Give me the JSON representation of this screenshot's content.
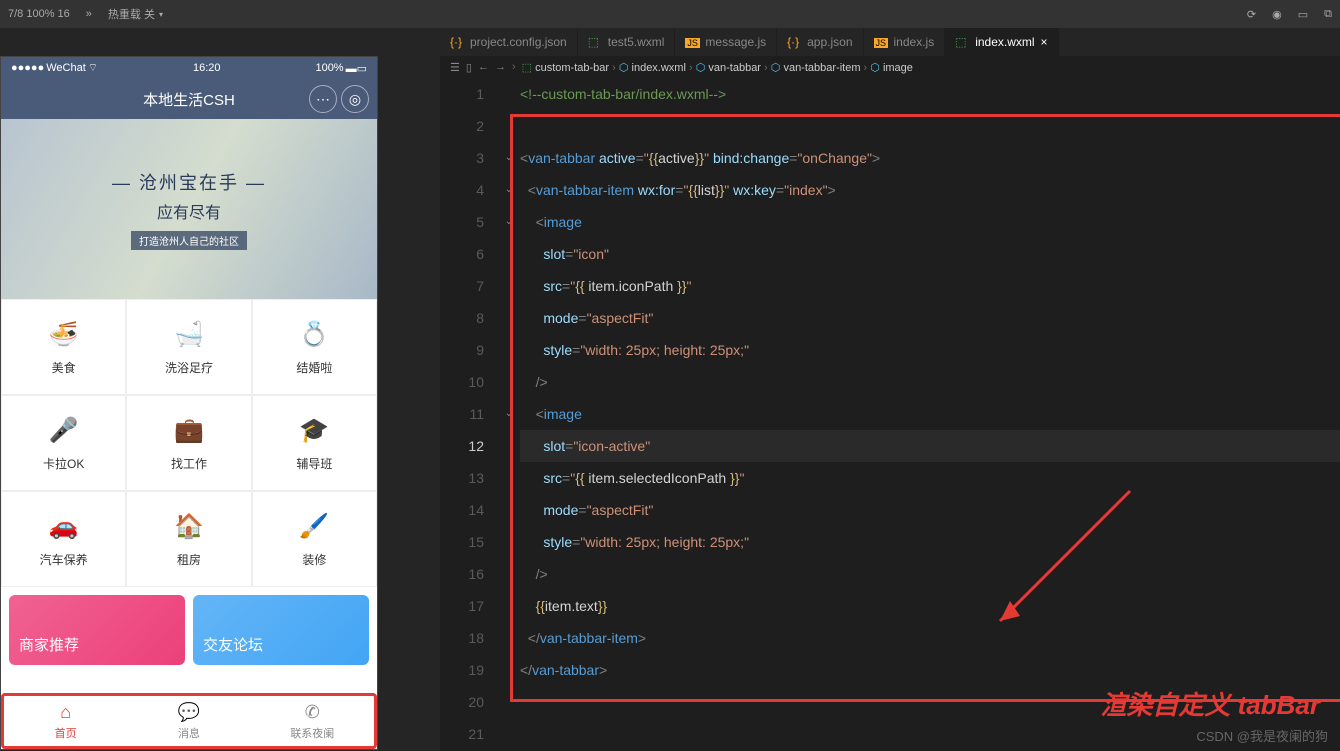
{
  "topbar": {
    "pct": "7/8 100% 16",
    "reload": "热重载 关",
    "chev": "»"
  },
  "phone": {
    "wechat": "WeChat",
    "time": "16:20",
    "battery": "100%",
    "title": "本地生活CSH",
    "banner": {
      "t1": "— 沧州宝在手 —",
      "t2": "应有尽有",
      "t3": "打造沧州人自己的社区"
    },
    "grid": [
      {
        "icon": "🍜",
        "label": "美食",
        "color": "#4caf50"
      },
      {
        "icon": "🛁",
        "label": "洗浴足疗",
        "color": "#26c6da"
      },
      {
        "icon": "💍",
        "label": "结婚啦",
        "color": "#ff9800"
      },
      {
        "icon": "🎤",
        "label": "卡拉OK",
        "color": "#f06292"
      },
      {
        "icon": "💼",
        "label": "找工作",
        "color": "#42a5f5"
      },
      {
        "icon": "🎓",
        "label": "辅导班",
        "color": "#5c6bc0"
      },
      {
        "icon": "🚗",
        "label": "汽车保养",
        "color": "#4fc3f7"
      },
      {
        "icon": "🏠",
        "label": "租房",
        "color": "#ec407a"
      },
      {
        "icon": "🖌️",
        "label": "装修",
        "color": "#9ccc65"
      }
    ],
    "cards": {
      "c1": "商家推荐",
      "c2": "交友论坛"
    },
    "tabs": [
      {
        "icon": "⌂",
        "label": "首页",
        "active": true
      },
      {
        "icon": "💬",
        "label": "消息",
        "active": false
      },
      {
        "icon": "✆",
        "label": "联系夜阑",
        "active": false
      }
    ]
  },
  "editorTabs": [
    {
      "name": "project.config.json",
      "type": "json"
    },
    {
      "name": "test5.wxml",
      "type": "wxml"
    },
    {
      "name": "message.js",
      "type": "js"
    },
    {
      "name": "app.json",
      "type": "json"
    },
    {
      "name": "index.js",
      "type": "js"
    },
    {
      "name": "index.wxml",
      "type": "wxml",
      "active": true
    }
  ],
  "crumbs": [
    "custom-tab-bar",
    "index.wxml",
    "van-tabbar",
    "van-tabbar-item",
    "image"
  ],
  "lines": {
    "n": 21,
    "current": 12,
    "folds": [
      3,
      4,
      5,
      11
    ]
  },
  "annotation": "渲染自定义 tabBar",
  "watermark": "CSDN @我是夜阑的狗"
}
